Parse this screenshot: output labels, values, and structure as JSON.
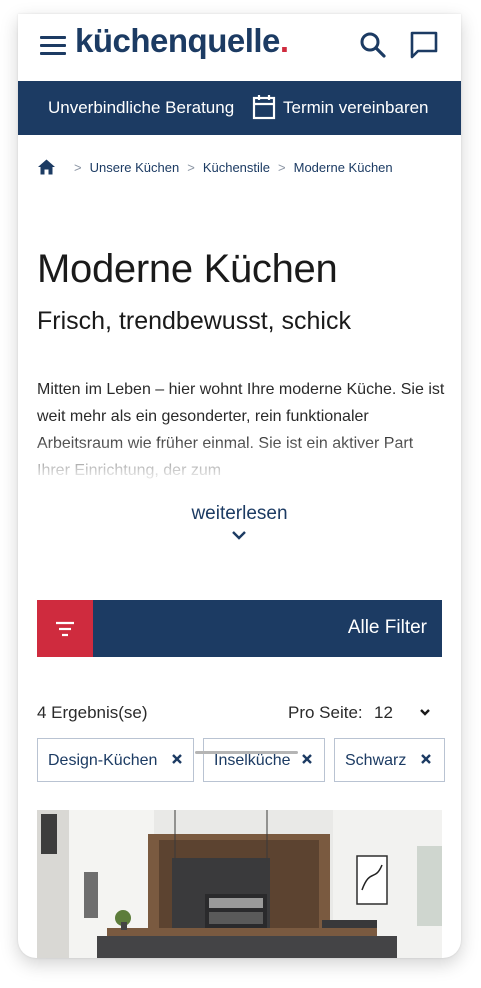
{
  "header": {
    "logo_text": "küchenquelle",
    "logo_dot": ".",
    "menu_icon": "hamburger-icon",
    "search_icon": "search-icon",
    "chat_icon": "chat-icon"
  },
  "banner": {
    "consultation": "Unverbindliche Beratung",
    "calendar_icon": "calendar-icon",
    "appointment": "Termin vereinbaren"
  },
  "breadcrumb": {
    "home_icon": "home-icon",
    "items": [
      "Unsere Küchen",
      "Küchenstile",
      "Moderne Küchen"
    ]
  },
  "page": {
    "title": "Moderne Küchen",
    "subtitle": "Frisch, trendbewusst, schick",
    "intro": "Mitten im Leben – hier wohnt Ihre moderne Küche. Sie ist weit mehr als ein gesonderter, rein funktionaler Arbeitsraum wie früher einmal. Sie ist ein aktiver Part Ihrer Einrichtung, der zum",
    "read_more": "weiterlesen"
  },
  "filters": {
    "label": "Alle Filter",
    "icon": "filter-icon"
  },
  "results": {
    "count": "4 Ergebnis(se)",
    "per_page_label": "Pro Seite:",
    "per_page_value": "12"
  },
  "chips": [
    "Design-Küchen",
    "Inselküche",
    "Schwarz"
  ],
  "colors": {
    "brand_navy": "#1c3b63",
    "accent_red": "#cf2b3e"
  }
}
